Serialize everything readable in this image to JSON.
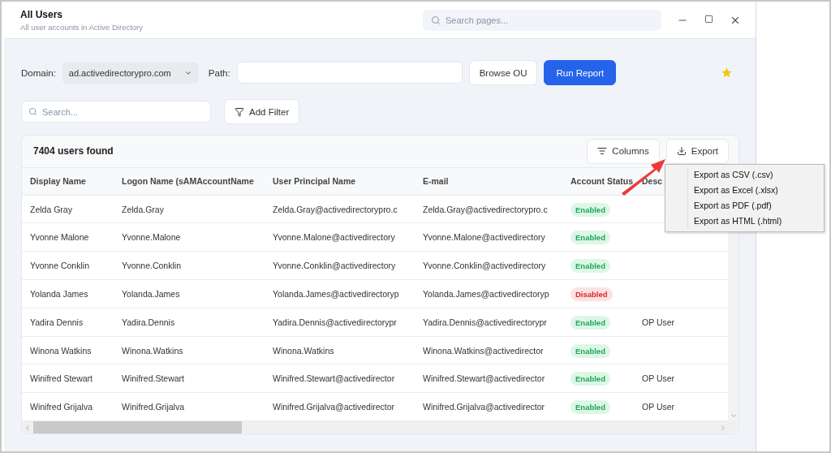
{
  "window": {
    "title": "All Users",
    "subtitle": "All user accounts in Active Directory",
    "search_placeholder": "Search pages..."
  },
  "toolbar": {
    "domain_label": "Domain:",
    "domain_value": "ad.activedirectorypro.com",
    "path_label": "Path:",
    "browse_button": "Browse OU",
    "run_button": "Run Report",
    "favorite": true
  },
  "filter": {
    "search_placeholder": "Search...",
    "add_filter_button": "Add Filter"
  },
  "results": {
    "count": "7404 users found",
    "columns_button": "Columns",
    "export_button": "Export"
  },
  "table": {
    "columns": [
      "Display Name",
      "Logon Name (sAMAccountName",
      "User Principal Name",
      "E-mail",
      "Account Status",
      "Desc"
    ],
    "rows": [
      {
        "display": "Zelda Gray",
        "logon": "Zelda.Gray",
        "upn": "Zelda.Gray@activedirectorypro.c",
        "email": "Zelda.Gray@activedirectorypro.c",
        "status": "Enabled",
        "kind": "enabled",
        "description": ""
      },
      {
        "display": "Yvonne Malone",
        "logon": "Yvonne.Malone",
        "upn": "Yvonne.Malone@activedirectory",
        "email": "Yvonne.Malone@activedirectory",
        "status": "Enabled",
        "kind": "enabled",
        "description": ""
      },
      {
        "display": "Yvonne Conklin",
        "logon": "Yvonne.Conklin",
        "upn": "Yvonne.Conklin@activedirectory",
        "email": "Yvonne.Conklin@activedirectory",
        "status": "Enabled",
        "kind": "enabled",
        "description": ""
      },
      {
        "display": "Yolanda James",
        "logon": "Yolanda.James",
        "upn": "Yolanda.James@activedirectoryp",
        "email": "Yolanda.James@activedirectoryp",
        "status": "Disabled",
        "kind": "disabled",
        "description": ""
      },
      {
        "display": "Yadira Dennis",
        "logon": "Yadira.Dennis",
        "upn": "Yadira.Dennis@activedirectorypr",
        "email": "Yadira.Dennis@activedirectorypr",
        "status": "Enabled",
        "kind": "enabled",
        "description": "OP User"
      },
      {
        "display": "Winona Watkins",
        "logon": "Winona.Watkins",
        "upn": "Winona.Watkins",
        "email": "Winona.Watkins@activedirector",
        "status": "Enabled",
        "kind": "enabled",
        "description": ""
      },
      {
        "display": "Winifred Stewart",
        "logon": "Winifred.Stewart",
        "upn": "Winifred.Stewart@activedirector",
        "email": "Winifred.Stewart@activedirector",
        "status": "Enabled",
        "kind": "enabled",
        "description": "OP User"
      },
      {
        "display": "Winifred Grijalva",
        "logon": "Winifred.Grijalva",
        "upn": "Winifred.Grijalva@activedirector",
        "email": "Winifred.Grijalva@activedirector",
        "status": "Enabled",
        "kind": "enabled",
        "description": "OP User"
      }
    ]
  },
  "export_menu": [
    "Export as CSV (.csv)",
    "Export as Excel (.xlsx)",
    "Export as PDF (.pdf)",
    "Export as HTML (.html)"
  ]
}
